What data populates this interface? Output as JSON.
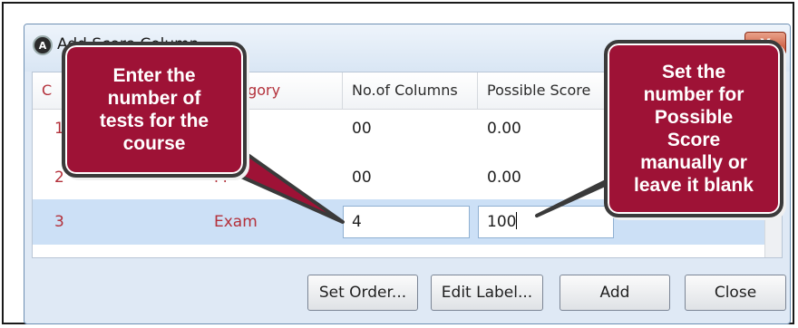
{
  "window": {
    "title": "Add Score Column",
    "icon_glyph": "A",
    "close_glyph": "X",
    "close_color": "#c4462a"
  },
  "grid": {
    "headers": [
      {
        "label": "C"
      },
      {
        "label": "Category"
      },
      {
        "label": "No.of Columns"
      },
      {
        "label": "Possible Score"
      }
    ],
    "rows": [
      {
        "num": "1",
        "category": "",
        "columns": "00",
        "score": "0.00"
      },
      {
        "num": "2",
        "category": "M",
        "columns": "00",
        "score": "0.00"
      },
      {
        "num": "3",
        "category": "Exam",
        "columns": "4",
        "score": "100"
      }
    ]
  },
  "buttons": {
    "set_order": "Set Order...",
    "edit_label": "Edit Label...",
    "add": "Add",
    "close": "Close"
  },
  "callouts": {
    "left": [
      "Enter the",
      "number of",
      "tests for the",
      "course"
    ],
    "right": [
      "Set the",
      "number for",
      "Possible",
      "Score",
      "manually or",
      "leave it blank"
    ]
  },
  "colors": {
    "callout_fill": "#9e1236",
    "selected_row": "#cce0f6",
    "accent_text": "#b3303a"
  }
}
